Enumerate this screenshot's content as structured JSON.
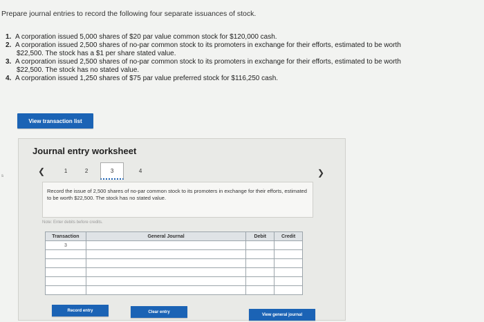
{
  "prompt": "Prepare journal entries to record the following four separate issuances of stock.",
  "items": [
    {
      "num": "1.",
      "lines": [
        "A corporation issued 5,000 shares of $20 par value common stock for $120,000 cash."
      ]
    },
    {
      "num": "2.",
      "lines": [
        "A corporation issued 2,500 shares of no-par common stock to its promoters in exchange for their efforts, estimated to be worth",
        "$22,500. The stock has a $1 per share stated value."
      ]
    },
    {
      "num": "3.",
      "lines": [
        "A corporation issued 2,500 shares of no-par common stock to its promoters in exchange for their efforts, estimated to be worth",
        "$22,500. The stock has no stated value."
      ]
    },
    {
      "num": "4.",
      "lines": [
        "A corporation issued 1,250 shares of $75 par value preferred stock for $116,250 cash."
      ]
    }
  ],
  "view_transaction_label": "View transaction list",
  "worksheet": {
    "title": "Journal entry worksheet",
    "prev_icon": "chevron-left-icon",
    "next_icon": "chevron-right-icon",
    "pages": [
      "1",
      "2",
      "3",
      "4"
    ],
    "active_page": "3",
    "description": "Record the issue of 2,500 shares of no-par common stock to its promoters in exchange for their efforts, estimated to be worth $22,500. The stock has no stated value.",
    "note": "Note: Enter debits before credits.",
    "table": {
      "headers": [
        "Transaction",
        "General Journal",
        "Debit",
        "Credit"
      ],
      "rows": [
        [
          "3",
          "",
          "",
          ""
        ],
        [
          "",
          "",
          "",
          ""
        ],
        [
          "",
          "",
          "",
          ""
        ],
        [
          "",
          "",
          "",
          ""
        ],
        [
          "",
          "",
          "",
          ""
        ],
        [
          "",
          "",
          "",
          ""
        ]
      ]
    },
    "record_label": "Record entry",
    "clear_label": "Clear entry",
    "general_journal_label": "View general journal"
  },
  "side_mark": "s",
  "colors": {
    "accent": "#1b63b5",
    "background": "#f2f3f1"
  }
}
